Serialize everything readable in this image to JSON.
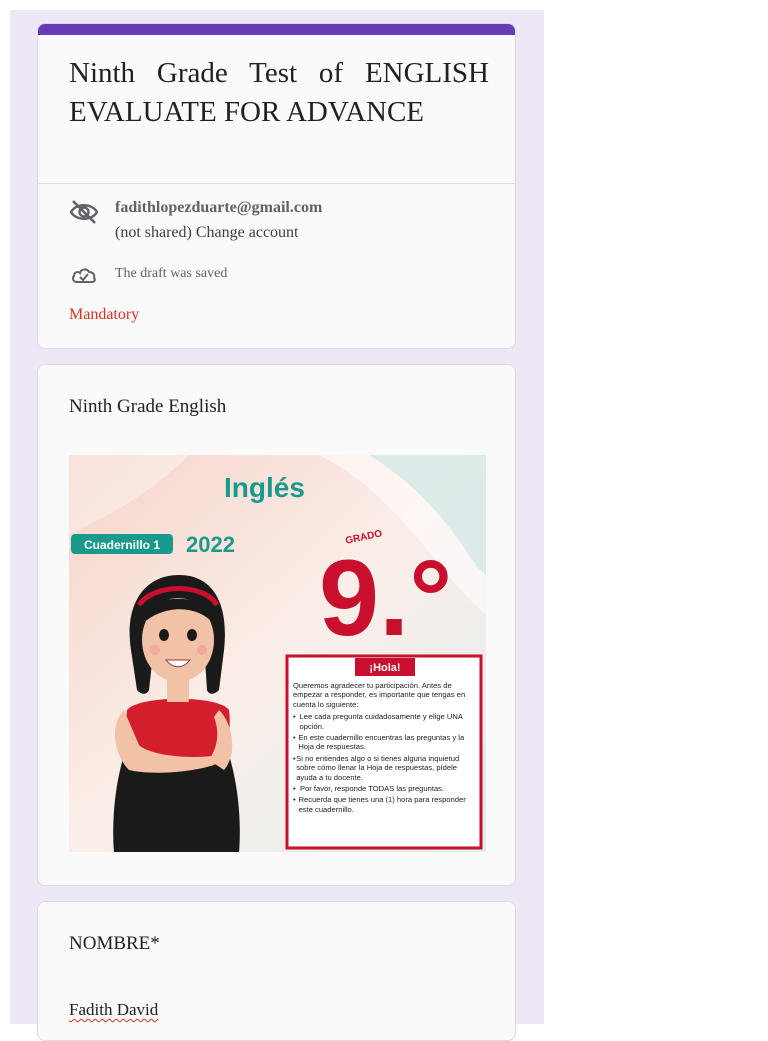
{
  "form": {
    "title": "Ninth Grade Test of ENGLISH EVALUATE FOR ADVANCE",
    "account_email": "fadithlopezduarte@gmail.com",
    "account_note": "(not shared) Change account",
    "draft_status": "The draft was saved",
    "required_note": "Mandatory"
  },
  "section": {
    "title": "Ninth Grade English",
    "cover": {
      "heading": "Inglés",
      "booklet_label": "Cuadernillo 1",
      "year": "2022",
      "grade_label": "GRADO",
      "grade_number": "9.°",
      "box_title": "¡Hola!",
      "box_intro": "Queremos agradecer tu participación. Antes de empezar a responder, es importante que tengas en cuenta lo siguiente:",
      "bullets": [
        "Lee cada pregunta cuidadosamente y elige UNA opción.",
        "En este cuadernillo encuentras las preguntas y la Hoja de respuestas.",
        "Si no entiendes algo o si tienes alguna inquietud sobre cómo llenar la Hoja de respuestas, pídele ayuda a tu docente.",
        "Por favor, responde TODAS las preguntas.",
        "Recuerda que tienes una (1) hora para responder este cuadernillo."
      ]
    }
  },
  "question": {
    "label": "NOMBRE*",
    "answer": "Fadith David"
  },
  "colors": {
    "accent": "#673ab7",
    "background": "#ede7f6",
    "required": "#d93025",
    "cover_teal": "#1a9a8c",
    "cover_red": "#c8102e"
  },
  "icons": [
    "visibility-off-icon",
    "cloud-done-icon"
  ]
}
